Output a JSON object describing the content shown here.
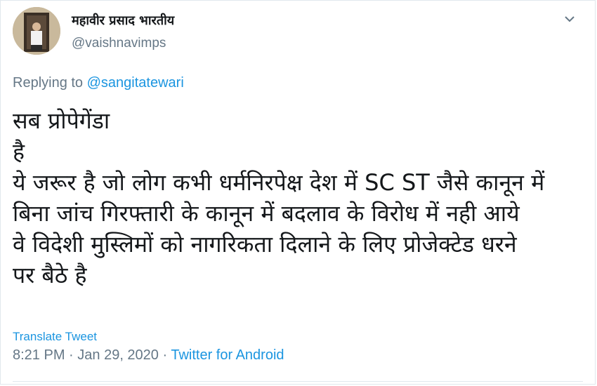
{
  "tweet": {
    "author_name": "महावीर प्रसाद भारतीय",
    "author_handle": "@vaishnavimps",
    "replying_prefix": "Replying to",
    "replying_to": "@sangitatewari",
    "body_lines": [
      "सब प्रोपेगेंडा",
      "है",
      "ये जरूर है जो लोग कभी धर्मनिरपेक्ष देश में SC ST जैसे कानून में",
      "बिना जांच गिरफ्तारी के कानून में बदलाव के विरोध में नही आये",
      "वे विदेशी मुस्लिमों को नागरिकता दिलाने के लिए प्रोजेक्टेड धरने",
      "पर बैठे है"
    ],
    "translate_label": "Translate Tweet",
    "time": "8:21 PM",
    "date": "Jan 29, 2020",
    "separator": " · ",
    "source": "Twitter for Android"
  },
  "icons": {
    "menu": "chevron-down-icon",
    "avatar": "avatar"
  },
  "colors": {
    "link": "#1b95e0",
    "muted": "#657786",
    "text": "#14171a"
  }
}
